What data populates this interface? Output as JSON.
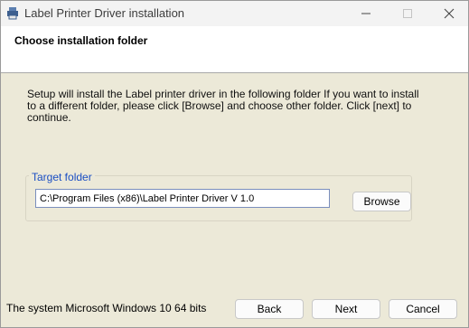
{
  "window": {
    "title": "Label Printer Driver installation",
    "icons": {
      "app": "installer-icon",
      "minimize": "minimize-icon",
      "maximize": "maximize-icon",
      "close": "close-icon"
    }
  },
  "header": {
    "title": "Choose installation folder"
  },
  "description": "Setup will install the Label printer driver in the following folder If you want to install to a different folder, please click [Browse] and choose other folder. Click [next] to continue.",
  "target_folder": {
    "label": "Target folder",
    "path": "C:\\Program Files (x86)\\Label Printer Driver V 1.0",
    "browse_label": "Browse"
  },
  "footer": {
    "status": "The system Microsoft Windows 10 64 bits",
    "back_label": "Back",
    "next_label": "Next",
    "cancel_label": "Cancel"
  }
}
